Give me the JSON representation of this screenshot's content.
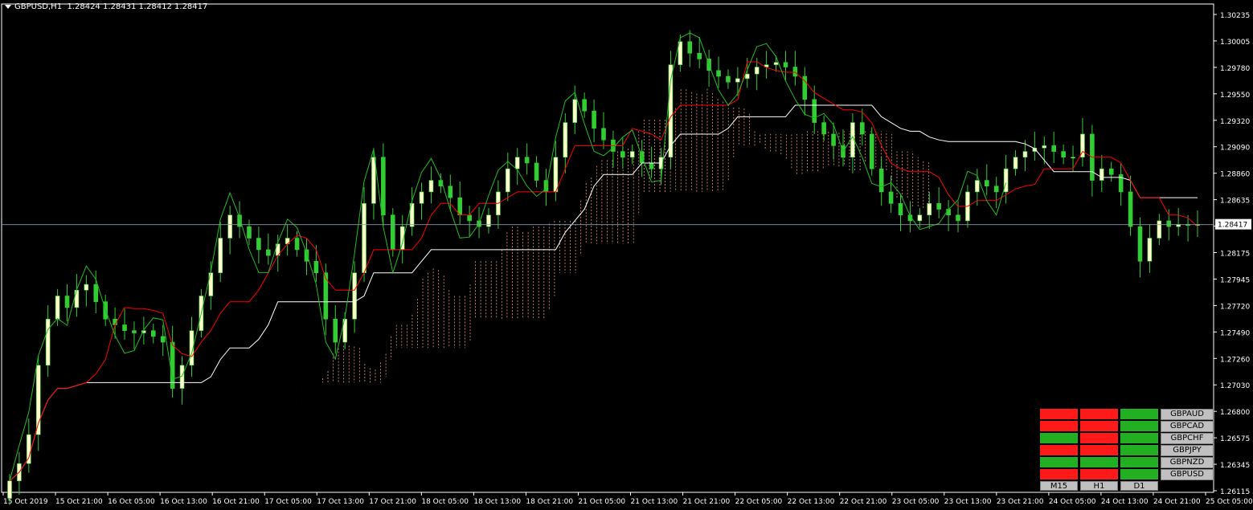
{
  "header": {
    "symbol": "GBPUSD,H1",
    "quote": "1.28424 1.28431 1.28412 1.28417"
  },
  "price_axis": {
    "ticks": [
      "1.30235",
      "1.30005",
      "1.29780",
      "1.29550",
      "1.29320",
      "1.29090",
      "1.28860",
      "1.28635",
      "1.28405",
      "1.28175",
      "1.27945",
      "1.27720",
      "1.27490",
      "1.27260",
      "1.27030",
      "1.26800",
      "1.26575",
      "1.26345",
      "1.26115"
    ],
    "current_price": "1.28417"
  },
  "time_axis": {
    "ticks": [
      "15 Oct 2019",
      "15 Oct 21:00",
      "16 Oct 05:00",
      "16 Oct 13:00",
      "16 Oct 21:00",
      "17 Oct 05:00",
      "17 Oct 13:00",
      "17 Oct 21:00",
      "18 Oct 05:00",
      "18 Oct 13:00",
      "18 Oct 21:00",
      "21 Oct 05:00",
      "21 Oct 13:00",
      "21 Oct 21:00",
      "22 Oct 05:00",
      "22 Oct 13:00",
      "22 Oct 21:00",
      "23 Oct 05:00",
      "23 Oct 13:00",
      "23 Oct 21:00",
      "24 Oct 05:00",
      "24 Oct 13:00",
      "24 Oct 21:00",
      "25 Oct 05:00"
    ]
  },
  "colors": {
    "background": "#000000",
    "axis": "#ffffff",
    "bull": "#ffffcc",
    "bear": "#32cd32",
    "tenkan": "#ff0000",
    "kijun": "#ffffff",
    "chikou": "#22bb22",
    "cloud": "#e9967a",
    "signal_red": "#ff1a1a",
    "signal_green": "#22b022"
  },
  "matrix": {
    "rows": [
      {
        "symbol": "GBPAUD",
        "signals": [
          "red",
          "red",
          "green"
        ]
      },
      {
        "symbol": "GBPCAD",
        "signals": [
          "red",
          "red",
          "green"
        ]
      },
      {
        "symbol": "GBPCHF",
        "signals": [
          "green",
          "red",
          "green"
        ]
      },
      {
        "symbol": "GBPJPY",
        "signals": [
          "red",
          "red",
          "green"
        ]
      },
      {
        "symbol": "GBPNZD",
        "signals": [
          "green",
          "green",
          "green"
        ]
      },
      {
        "symbol": "GBPUSD",
        "signals": [
          "red",
          "red",
          "green"
        ]
      }
    ],
    "timeframes": [
      "M15",
      "H1",
      "D1"
    ]
  },
  "chart_data": {
    "type": "candlestick",
    "ylim": [
      1.26115,
      1.30235
    ],
    "closes": [
      1.262,
      1.2635,
      1.266,
      1.272,
      1.276,
      1.278,
      1.277,
      1.2785,
      1.279,
      1.2775,
      1.276,
      1.2755,
      1.275,
      1.2748,
      1.275,
      1.2745,
      1.274,
      1.27,
      1.272,
      1.275,
      1.278,
      1.28,
      1.283,
      1.285,
      1.284,
      1.283,
      1.282,
      1.2815,
      1.2825,
      1.283,
      1.282,
      1.281,
      1.28,
      1.276,
      1.274,
      1.276,
      1.28,
      1.286,
      1.29,
      1.285,
      1.282,
      1.284,
      1.286,
      1.287,
      1.288,
      1.2875,
      1.2865,
      1.285,
      1.2845,
      1.284,
      1.285,
      1.287,
      1.289,
      1.29,
      1.2895,
      1.288,
      1.287,
      1.29,
      1.293,
      1.295,
      1.294,
      1.2925,
      1.2915,
      1.2905,
      1.29,
      1.2905,
      1.2895,
      1.289,
      1.29,
      1.298,
      1.3,
      1.299,
      1.2985,
      1.2975,
      1.297,
      1.2965,
      1.2968,
      1.2972,
      1.2978,
      1.298,
      1.2982,
      1.2978,
      1.297,
      1.295,
      1.293,
      1.292,
      1.291,
      1.29,
      1.293,
      1.292,
      1.289,
      1.287,
      1.286,
      1.285,
      1.2845,
      1.285,
      1.286,
      1.2855,
      1.285,
      1.2845,
      1.287,
      1.288,
      1.2875,
      1.287,
      1.289,
      1.29,
      1.2905,
      1.2908,
      1.291,
      1.2905,
      1.29,
      1.29,
      1.292,
      1.288,
      1.289,
      1.2885,
      1.287,
      1.284,
      1.281,
      1.283,
      1.2845,
      1.284,
      1.2842,
      1.2841,
      1.2842
    ]
  }
}
